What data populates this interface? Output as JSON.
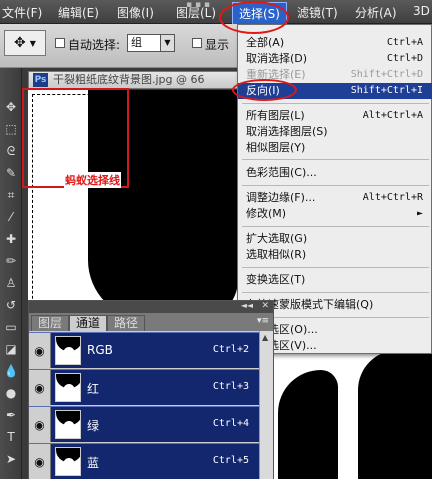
{
  "menubar": {
    "items": [
      "文件(F)",
      "编辑(E)",
      "图像(I)",
      "图层(L)",
      "选择(S)",
      "滤镜(T)",
      "分析(A)",
      "3D"
    ]
  },
  "options": {
    "auto_select_label": "自动选择:",
    "auto_select_value": "组",
    "show_label": "显示"
  },
  "document": {
    "title": "干裂粗纸底纹背景图.jpg @ 66",
    "ps_badge": "Ps"
  },
  "annotation": {
    "text": "蚂蚁选择线"
  },
  "menu": {
    "items": [
      {
        "label": "全部(A)",
        "shortcut": "Ctrl+A",
        "state": "normal"
      },
      {
        "label": "取消选择(D)",
        "shortcut": "Ctrl+D",
        "state": "normal"
      },
      {
        "label": "重新选择(E)",
        "shortcut": "Shift+Ctrl+D",
        "state": "disabled"
      },
      {
        "label": "反向(I)",
        "shortcut": "Shift+Ctrl+I",
        "state": "highlighted"
      },
      {
        "label": "所有图层(L)",
        "shortcut": "Alt+Ctrl+A",
        "state": "normal"
      },
      {
        "label": "取消选择图层(S)",
        "shortcut": "",
        "state": "normal"
      },
      {
        "label": "相似图层(Y)",
        "shortcut": "",
        "state": "normal"
      },
      {
        "label": "色彩范围(C)...",
        "shortcut": "",
        "state": "normal"
      },
      {
        "label": "调整边缘(F)...",
        "shortcut": "Alt+Ctrl+R",
        "state": "normal"
      },
      {
        "label": "修改(M)",
        "shortcut": "",
        "state": "normal"
      },
      {
        "label": "扩大选取(G)",
        "shortcut": "",
        "state": "normal"
      },
      {
        "label": "选取相似(R)",
        "shortcut": "",
        "state": "normal"
      },
      {
        "label": "变换选区(T)",
        "shortcut": "",
        "state": "normal"
      },
      {
        "label": "在快速蒙版模式下编辑(Q)",
        "shortcut": "",
        "state": "normal"
      },
      {
        "label": "载入选区(O)...",
        "shortcut": "",
        "state": "normal"
      },
      {
        "label": "存储选区(V)...",
        "shortcut": "",
        "state": "normal"
      }
    ]
  },
  "panel": {
    "tabs": [
      "图层",
      "通道",
      "路径"
    ],
    "channels": [
      {
        "name": "RGB",
        "shortcut": "Ctrl+2"
      },
      {
        "name": "红",
        "shortcut": "Ctrl+3"
      },
      {
        "name": "绿",
        "shortcut": "Ctrl+4"
      },
      {
        "name": "蓝",
        "shortcut": "Ctrl+5"
      }
    ]
  }
}
